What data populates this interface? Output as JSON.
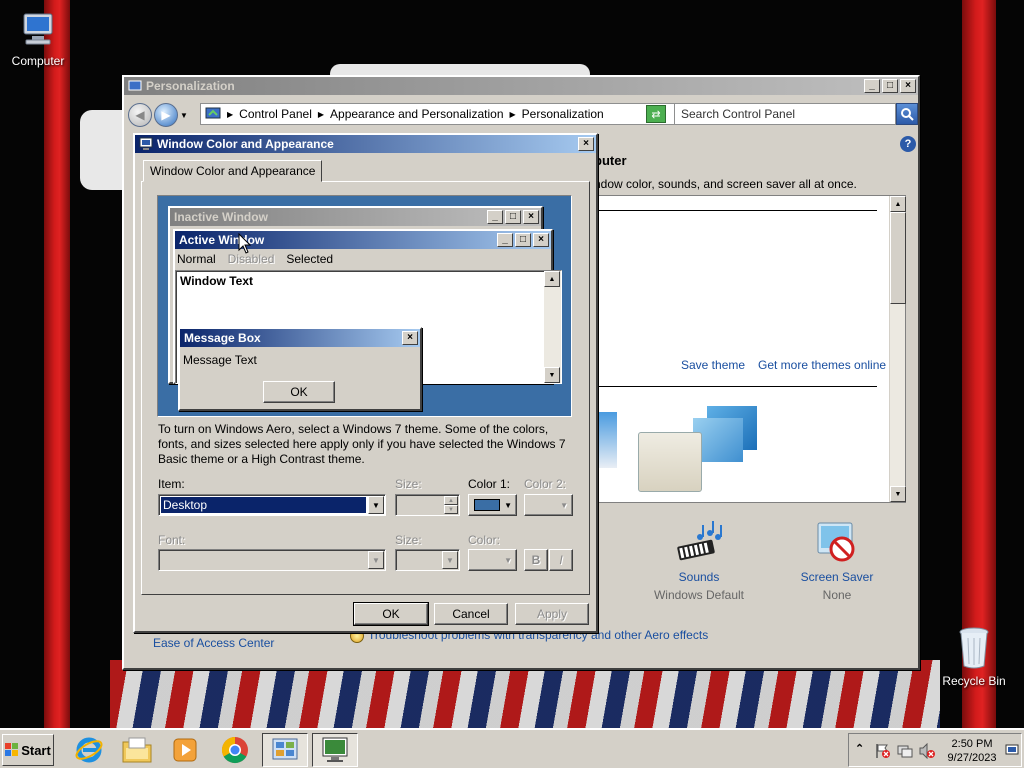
{
  "desktop": {
    "icons": [
      {
        "label": "Computer",
        "icon": "computer-icon"
      },
      {
        "label": "Recycle Bin",
        "icon": "recycle-bin-icon"
      }
    ]
  },
  "personalization": {
    "title": "Personalization",
    "breadcrumbs": [
      "Control Panel",
      "Appearance and Personalization",
      "Personalization"
    ],
    "search_placeholder": "Search Control Panel",
    "heading_fragment": "puter",
    "subheading_fragment": "ndow color, sounds, and screen saver all at once.",
    "save_theme": "Save theme",
    "get_more_themes": "Get more themes online",
    "sounds_label": "Sounds",
    "sounds_value": "Windows Default",
    "screensaver_label": "Screen Saver",
    "screensaver_value": "None",
    "ease_of_access": "Ease of Access Center",
    "troubleshoot": "Troubleshoot problems with transparency and other Aero effects"
  },
  "dialog": {
    "title": "Window Color and Appearance",
    "tab_label": "Window Color and Appearance",
    "preview": {
      "inactive_title": "Inactive Window",
      "active_title": "Active Window",
      "menu_normal": "Normal",
      "menu_disabled": "Disabled",
      "menu_selected": "Selected",
      "window_text": "Window Text",
      "msgbox_title": "Message Box",
      "msgbox_text": "Message Text",
      "msgbox_ok": "OK"
    },
    "description": "To turn on Windows Aero, select a Windows 7 theme.  Some of the colors, fonts, and sizes selected here apply only if you have selected the Windows 7 Basic theme or a High Contrast theme.",
    "item_label": "Item:",
    "item_value": "Desktop",
    "size_label": "Size:",
    "color1_label": "Color 1:",
    "color2_label": "Color 2:",
    "font_label": "Font:",
    "font_size_label": "Size:",
    "font_color_label": "Color:",
    "bold_label": "B",
    "italic_label": "I",
    "ok": "OK",
    "cancel": "Cancel",
    "apply": "Apply",
    "color1_swatch": "#3a6ea5"
  },
  "taskbar": {
    "start_label": "Start",
    "time": "2:50 PM",
    "date": "9/27/2023"
  },
  "colors": {
    "title_active_start": "#0a246a",
    "title_active_end": "#a6caf0",
    "preview_desktop": "#3a6ea5",
    "selection": "#0a246a"
  }
}
